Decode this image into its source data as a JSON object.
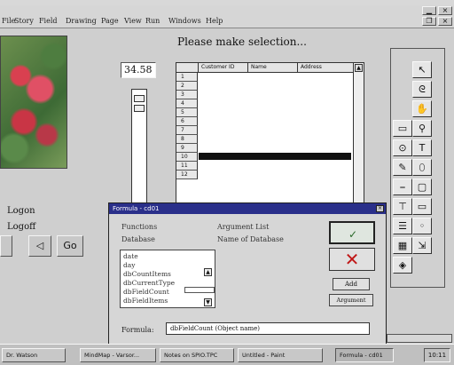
{
  "menu": {
    "items": [
      "File",
      "Story",
      "Field",
      "Drawing",
      "Page",
      "View",
      "Run",
      "Windows",
      "Help"
    ]
  },
  "page": {
    "title": "Please make selection...",
    "number_value": "34.58"
  },
  "grid": {
    "columns": [
      "Customer ID",
      "Name",
      "Address"
    ],
    "row_numbers": [
      "1",
      "2",
      "3",
      "4",
      "5",
      "6",
      "7",
      "8",
      "9",
      "10",
      "11",
      "12"
    ],
    "selected_row": "8"
  },
  "left_panel": {
    "logon": "Logon",
    "logoff": "Logoff",
    "back_glyph": "◁",
    "go_label": "Go"
  },
  "palette": {
    "tools": [
      "pointer-icon",
      "lasso-icon",
      "hand-icon",
      "rectangle-icon",
      "zoom-icon",
      "circle-icon",
      "text-icon",
      "paint-icon",
      "oval-icon",
      "line-icon",
      "rounded-rect-icon",
      "field-icon",
      "button-icon",
      "listbox-icon",
      "radio-icon",
      "picture-icon",
      "scroll-icon",
      "star-icon"
    ]
  },
  "dialog": {
    "title": "Formula - cd01",
    "functions_label": "Functions",
    "argument_list_label": "Argument List",
    "database_label": "Database",
    "argument_value": "Name of Database",
    "functions": [
      "date",
      "day",
      "dbCountItems",
      "dbCurrentType",
      "dbFieldCount",
      "dbFieldItems"
    ],
    "add_label": "Add",
    "argument_button_label": "Argument",
    "formula_label": "Formula:",
    "formula_value": "dbFieldCount (Object name)"
  },
  "taskbar": {
    "items": [
      "Dr. Watson",
      "MindMap - Varsor...",
      "Notes on SPIO.TPC",
      "Untitled - Paint",
      "Formula - cd01"
    ],
    "clock": "10:11"
  }
}
